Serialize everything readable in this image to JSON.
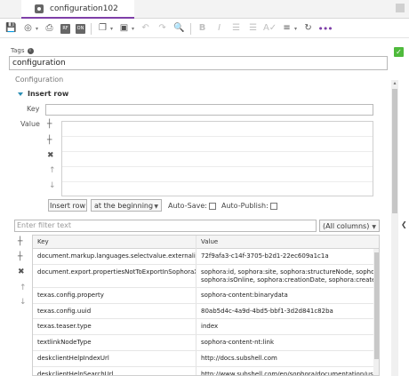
{
  "tab": {
    "title": "configuration102"
  },
  "toolbar": {
    "icons": [
      "save-icon",
      "globe-icon",
      "print-icon",
      "rf-icon",
      "on-icon",
      "copy-icon",
      "image-icon",
      "undo-icon",
      "redo-icon",
      "find-icon",
      "bold-icon",
      "italic-icon",
      "bullet-list-icon",
      "numbered-list-icon",
      "spellcheck-icon",
      "align-icon",
      "refresh-icon",
      "more-icon"
    ],
    "rf_label": "RF",
    "on_label": "ON"
  },
  "tags": {
    "label": "Tags",
    "value": "configuration"
  },
  "section": {
    "label": "Configuration"
  },
  "insert_row": {
    "heading": "Insert row",
    "key_label": "Key",
    "value_label": "Value",
    "button_label": "Insert row",
    "position_select": "at the beginning",
    "auto_save_label": "Auto-Save:",
    "auto_publish_label": "Auto-Publish:"
  },
  "filter": {
    "placeholder": "Enter filter text",
    "columns_select": "(All columns)"
  },
  "table": {
    "columns": [
      "Key",
      "Value"
    ],
    "rows": [
      {
        "key": "document.markup.languages.selectvalue.externalid",
        "value": [
          "72f9afa3-c14f-3705-b2d1-22ec609a1c1a"
        ]
      },
      {
        "key": "document.export.propertiesNotToExportInSophoraXml",
        "value": [
          "sophora:id, sophora:site, sophora:structureNode, sophora:ca",
          "sophora:isOnline, sophora:creationDate, sophora:createdBy,"
        ]
      },
      {
        "key": "texas.config.property",
        "value": [
          "sophora-content:binarydata"
        ]
      },
      {
        "key": "texas.config.uuid",
        "value": [
          "80ab5d4c-4a9d-4bd5-bbf1-3d2d841c82ba"
        ]
      },
      {
        "key": "texas.teaser.type",
        "value": [
          "index"
        ]
      },
      {
        "key": "textlinkNodeType",
        "value": [
          "sophora-content-nt:link"
        ]
      },
      {
        "key": "deskclientHelpIndexUrl",
        "value": [
          "http://docs.subshell.com"
        ]
      },
      {
        "key": "deskclientHelpSearchUrl",
        "value": [
          "http://www.subshell.com/en/sophora/documentation/user-c"
        ]
      }
    ]
  },
  "colors": {
    "accent": "#7e3fa8",
    "link_blue": "#2d8fb5",
    "check_green": "#4fba3c"
  }
}
